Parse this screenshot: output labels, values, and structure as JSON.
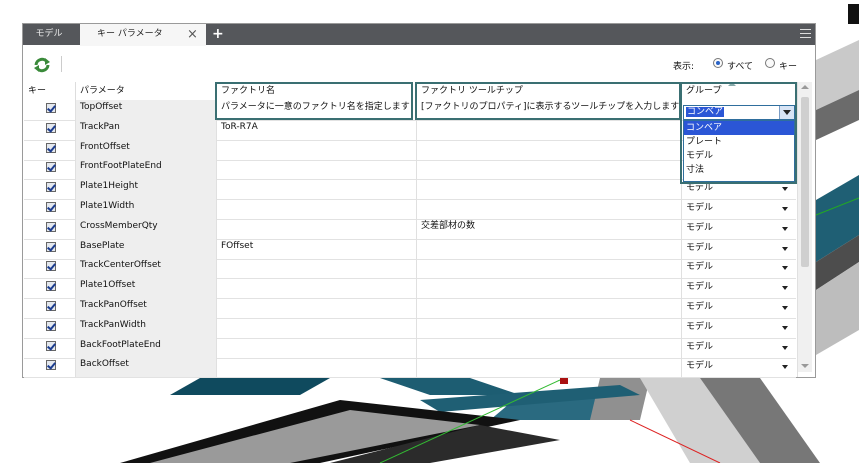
{
  "tabs": {
    "model": "モデル",
    "key_params": "キー パラメータ",
    "close": "×",
    "add": "+"
  },
  "toolbar": {
    "display_label": "表示:",
    "radio_all": "すべて",
    "radio_key": "キー"
  },
  "columns": {
    "key": "キー",
    "param": "パラメータ",
    "factory_name": "ファクトリ名",
    "factory_tooltip": "ファクトリ ツールチップ",
    "group": "グループ"
  },
  "rows": [
    {
      "param": "TopOffset",
      "name": "パラメータに一意のファクトリ名を指定します",
      "tooltip": "[ファクトリのプロパティ]に表示するツールチップを入力します",
      "group": "コンベア"
    },
    {
      "param": "TrackPan",
      "name": "ToR-R7A",
      "tooltip": "",
      "group": ""
    },
    {
      "param": "FrontOffset",
      "name": "",
      "tooltip": "",
      "group": ""
    },
    {
      "param": "FrontFootPlateEnd",
      "name": "",
      "tooltip": "",
      "group": ""
    },
    {
      "param": "Plate1Height",
      "name": "",
      "tooltip": "",
      "group": "モデル"
    },
    {
      "param": "Plate1Width",
      "name": "",
      "tooltip": "",
      "group": "モデル"
    },
    {
      "param": "CrossMemberQty",
      "name": "",
      "tooltip": "交差部材の数",
      "group": "モデル"
    },
    {
      "param": "BasePlate",
      "name": "FOffset",
      "tooltip": "",
      "group": "モデル"
    },
    {
      "param": "TrackCenterOffset",
      "name": "",
      "tooltip": "",
      "group": "モデル"
    },
    {
      "param": "Plate1Offset",
      "name": "",
      "tooltip": "",
      "group": "モデル"
    },
    {
      "param": "TrackPanOffset",
      "name": "",
      "tooltip": "",
      "group": "モデル"
    },
    {
      "param": "TrackPanWidth",
      "name": "",
      "tooltip": "",
      "group": "モデル"
    },
    {
      "param": "BackFootPlateEnd",
      "name": "",
      "tooltip": "",
      "group": "モデル"
    },
    {
      "param": "BackOffset",
      "name": "",
      "tooltip": "",
      "group": "モデル"
    }
  ],
  "dropdown": {
    "current": "コンベア",
    "options": [
      "コンベア",
      "プレート",
      "モデル",
      "寸法"
    ]
  },
  "colors": {
    "tabbar": "#55575b",
    "highlight": "#3a6f72",
    "selection": "#2b56d6"
  }
}
